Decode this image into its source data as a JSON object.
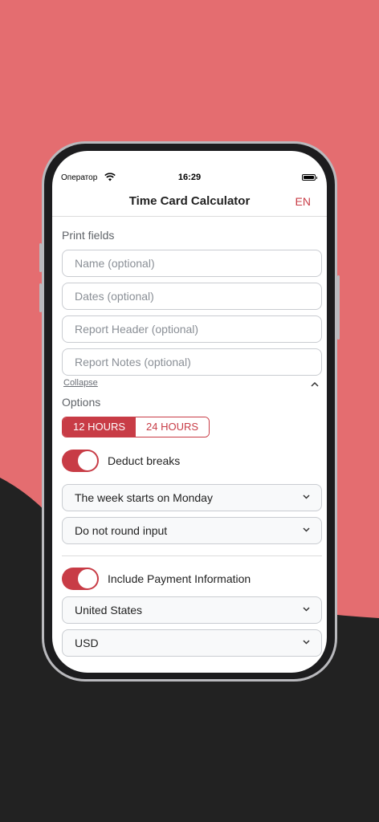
{
  "status_bar": {
    "carrier": "Оператор",
    "time": "16:29"
  },
  "navbar": {
    "title": "Time Card Calculator",
    "language": "EN"
  },
  "print_fields": {
    "title": "Print fields",
    "name_placeholder": "Name (optional)",
    "dates_placeholder": "Dates (optional)",
    "header_placeholder": "Report Header (optional)",
    "notes_placeholder": "Report Notes (optional)",
    "collapse_label": "Collapse"
  },
  "options": {
    "title": "Options",
    "hours_12": "12 HOURS",
    "hours_24": "24 HOURS",
    "selected_format": "12 HOURS",
    "deduct_breaks_label": "Deduct breaks",
    "deduct_breaks_on": true,
    "week_start": "The week starts on Monday",
    "rounding": "Do not round input"
  },
  "payment": {
    "include_label": "Include Payment Information",
    "include_on": true,
    "country": "United States",
    "currency": "USD"
  },
  "colors": {
    "accent": "#c83c46",
    "background_coral": "#e46d70",
    "background_dark": "#222222"
  }
}
